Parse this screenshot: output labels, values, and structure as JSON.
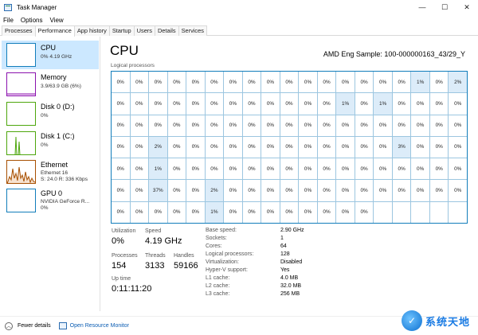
{
  "window": {
    "title": "Task Manager",
    "controls": [
      "—",
      "☐",
      "✕"
    ]
  },
  "menu": [
    "File",
    "Options",
    "View"
  ],
  "tabs": [
    {
      "label": "Processes",
      "active": false
    },
    {
      "label": "Performance",
      "active": true
    },
    {
      "label": "App history",
      "active": false
    },
    {
      "label": "Startup",
      "active": false
    },
    {
      "label": "Users",
      "active": false
    },
    {
      "label": "Details",
      "active": false
    },
    {
      "label": "Services",
      "active": false
    }
  ],
  "sidebar": [
    {
      "name": "CPU",
      "line1": "0% 4.19 GHz",
      "line2": "",
      "color": "#117dbb",
      "selected": true
    },
    {
      "name": "Memory",
      "line1": "3.9/63.9 GB (6%)",
      "line2": "",
      "color": "#8b12ae",
      "selected": false
    },
    {
      "name": "Disk 0 (D:)",
      "line1": "0%",
      "line2": "",
      "color": "#4da60c",
      "selected": false
    },
    {
      "name": "Disk 1 (C:)",
      "line1": "0%",
      "line2": "",
      "color": "#4da60c",
      "selected": false
    },
    {
      "name": "Ethernet",
      "line1": "Ethernet 16",
      "line2": "S: 24.0  R: 336 Kbps",
      "color": "#a74f01",
      "selected": false
    },
    {
      "name": "GPU 0",
      "line1": "NVIDIA GeForce R...",
      "line2": "0%",
      "color": "#117dbb",
      "selected": false
    }
  ],
  "main": {
    "title": "CPU",
    "model": "AMD Eng Sample: 100-000000163_43/29_Y",
    "grid_label": "Logical processors",
    "cells": [
      "0%",
      "0%",
      "0%",
      "0%",
      "0%",
      "0%",
      "0%",
      "0%",
      "0%",
      "0%",
      "0%",
      "0%",
      "0%",
      "0%",
      "0%",
      "0%",
      "1%",
      "0%",
      "2%",
      "0%",
      "0%",
      "0%",
      "0%",
      "0%",
      "0%",
      "0%",
      "0%",
      "0%",
      "0%",
      "0%",
      "0%",
      "1%",
      "0%",
      "1%",
      "0%",
      "0%",
      "0%",
      "0%",
      "0%",
      "0%",
      "0%",
      "0%",
      "0%",
      "0%",
      "0%",
      "0%",
      "0%",
      "0%",
      "0%",
      "0%",
      "0%",
      "0%",
      "0%",
      "0%",
      "0%",
      "0%",
      "0%",
      "0%",
      "0%",
      "2%",
      "0%",
      "0%",
      "0%",
      "0%",
      "0%",
      "0%",
      "0%",
      "0%",
      "0%",
      "0%",
      "0%",
      "0%",
      "3%",
      "0%",
      "0%",
      "0%",
      "0%",
      "0%",
      "1%",
      "0%",
      "0%",
      "0%",
      "0%",
      "0%",
      "0%",
      "0%",
      "0%",
      "0%",
      "0%",
      "0%",
      "0%",
      "0%",
      "0%",
      "0%",
      "0%",
      "0%",
      "0%",
      "37%",
      "0%",
      "0%",
      "2%",
      "0%",
      "0%",
      "0%",
      "0%",
      "0%",
      "0%",
      "0%",
      "0%",
      "0%",
      "0%",
      "0%",
      "0%",
      "0%",
      "0%",
      "0%",
      "0%",
      "0%",
      "0%",
      "1%",
      "0%",
      "0%",
      "0%",
      "0%",
      "0%",
      "0%",
      "0%",
      "0%",
      "",
      "",
      "",
      "",
      ""
    ],
    "stats": {
      "utilization_label": "Utilization",
      "utilization": "0%",
      "speed_label": "Speed",
      "speed": "4.19 GHz",
      "processes_label": "Processes",
      "processes": "154",
      "threads_label": "Threads",
      "threads": "3133",
      "handles_label": "Handles",
      "handles": "59166",
      "uptime_label": "Up time",
      "uptime": "0:11:11:20"
    },
    "info": [
      {
        "k": "Base speed:",
        "v": "2.90 GHz"
      },
      {
        "k": "Sockets:",
        "v": "1"
      },
      {
        "k": "Cores:",
        "v": "64"
      },
      {
        "k": "Logical processors:",
        "v": "128"
      },
      {
        "k": "Virtualization:",
        "v": "Disabled"
      },
      {
        "k": "Hyper-V support:",
        "v": "Yes"
      },
      {
        "k": "L1 cache:",
        "v": "4.0 MB"
      },
      {
        "k": "L2 cache:",
        "v": "32.0 MB"
      },
      {
        "k": "L3 cache:",
        "v": "256 MB"
      }
    ]
  },
  "footer": {
    "fewer_details": "Fewer details",
    "open_resource_monitor": "Open Resource Monitor"
  },
  "watermark": {
    "text": "系统天地"
  }
}
